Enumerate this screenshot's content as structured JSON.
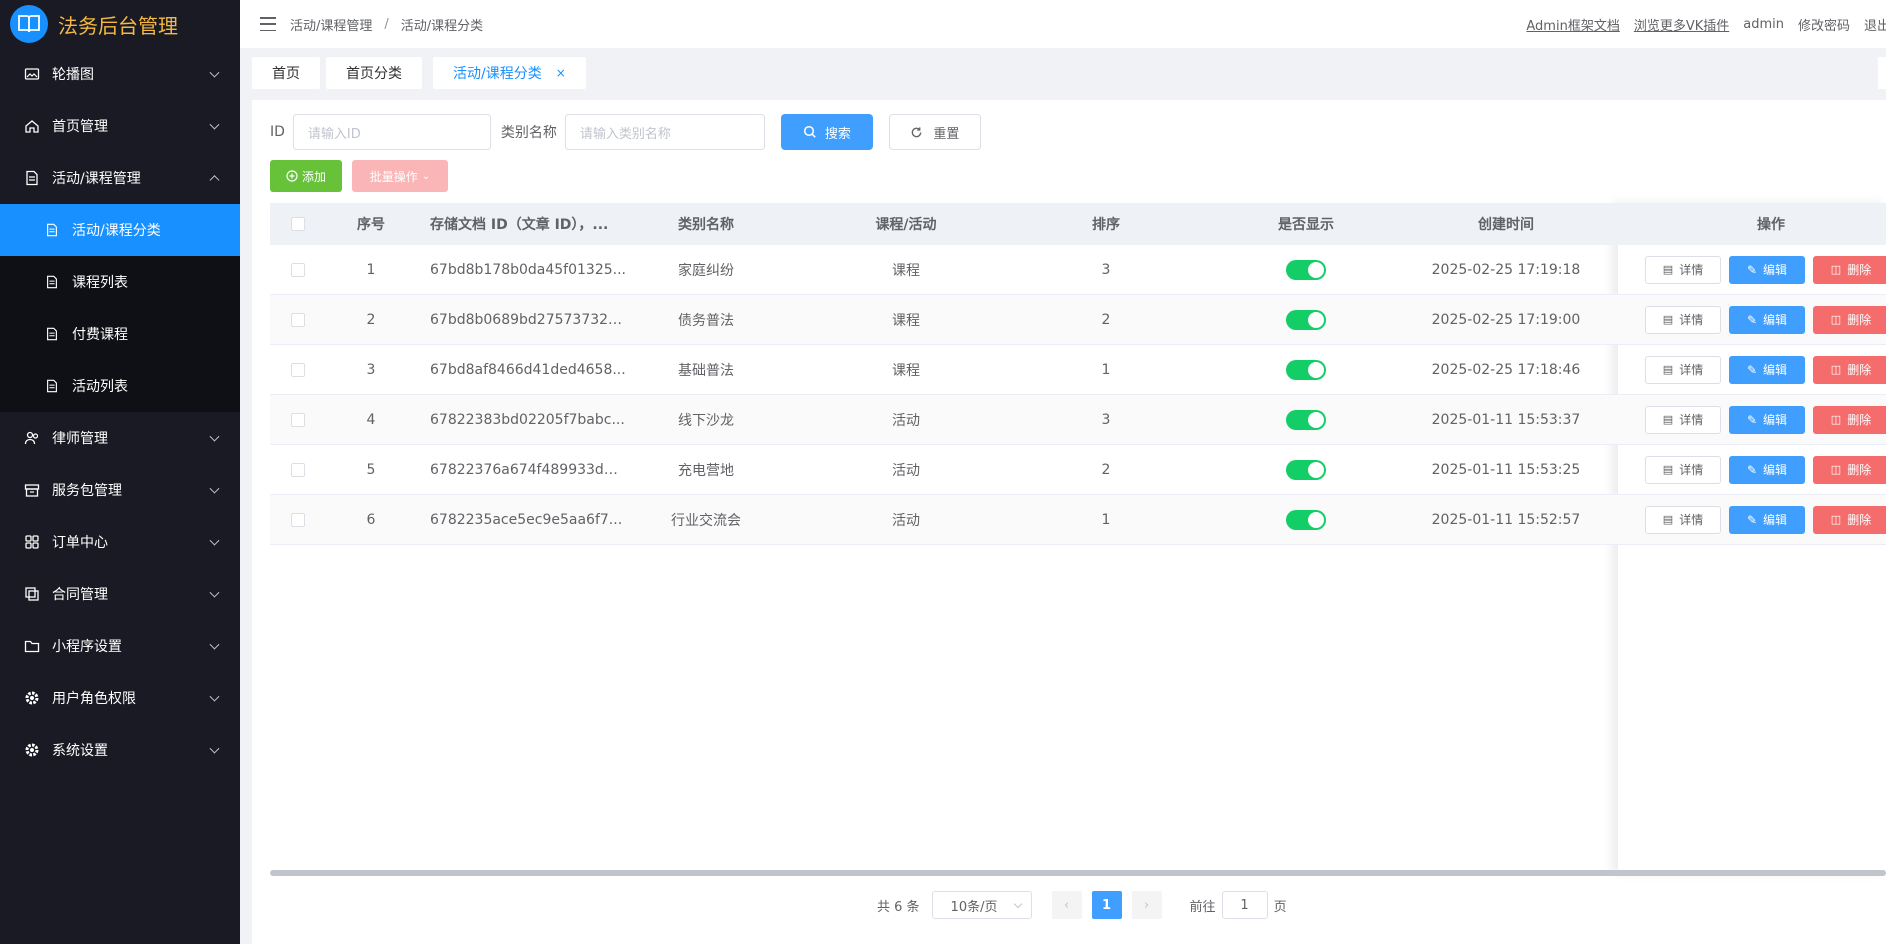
{
  "app": {
    "title": "法务后台管理"
  },
  "sidebar": {
    "items": [
      {
        "label": "轮播图",
        "icon": "image-icon"
      },
      {
        "label": "首页管理",
        "icon": "home-icon"
      },
      {
        "label": "活动/课程管理",
        "icon": "document-icon",
        "expanded": true,
        "children": [
          {
            "label": "活动/课程分类",
            "active": true
          },
          {
            "label": "课程列表"
          },
          {
            "label": "付费课程"
          },
          {
            "label": "活动列表"
          }
        ]
      },
      {
        "label": "律师管理",
        "icon": "user-group-icon"
      },
      {
        "label": "服务包管理",
        "icon": "box-icon"
      },
      {
        "label": "订单中心",
        "icon": "grid-icon"
      },
      {
        "label": "合同管理",
        "icon": "copy-icon"
      },
      {
        "label": "小程序设置",
        "icon": "folder-icon"
      },
      {
        "label": "用户角色权限",
        "icon": "gear-icon"
      },
      {
        "label": "系统设置",
        "icon": "gear-icon"
      }
    ]
  },
  "header": {
    "breadcrumb": [
      "活动/课程管理",
      "活动/课程分类"
    ],
    "links": [
      "Admin框架文档",
      "浏览更多VK插件"
    ],
    "user": "admin",
    "change_password": "修改密码",
    "logout": "退出"
  },
  "tabs": [
    {
      "label": "首页"
    },
    {
      "label": "首页分类"
    },
    {
      "label": "活动/课程分类",
      "active": true,
      "closable": "×"
    }
  ],
  "filters": {
    "id_label": "ID",
    "id_placeholder": "请输入ID",
    "name_label": "类别名称",
    "name_placeholder": "请输入类别名称",
    "search": "搜索",
    "reset": "重置"
  },
  "toolbar": {
    "add": "添加",
    "batch": "批量操作"
  },
  "table": {
    "columns": [
      "序号",
      "存储文档 ID（文章 ID），...",
      "类别名称",
      "课程/活动",
      "排序",
      "是否显示",
      "创建时间",
      "操作"
    ],
    "rows": [
      {
        "idx": "1",
        "doc": "67bd8b178b0da45f01325...",
        "name": "家庭纠纷",
        "type": "课程",
        "sort": "3",
        "show": true,
        "time": "2025-02-25 17:19:18"
      },
      {
        "idx": "2",
        "doc": "67bd8b0689bd27573732a...",
        "name": "债务普法",
        "type": "课程",
        "sort": "2",
        "show": true,
        "time": "2025-02-25 17:19:00"
      },
      {
        "idx": "3",
        "doc": "67bd8af8466d41ded4658...",
        "name": "基础普法",
        "type": "课程",
        "sort": "1",
        "show": true,
        "time": "2025-02-25 17:18:46"
      },
      {
        "idx": "4",
        "doc": "67822383bd02205f7babc...",
        "name": "线下沙龙",
        "type": "活动",
        "sort": "3",
        "show": true,
        "time": "2025-01-11 15:53:37"
      },
      {
        "idx": "5",
        "doc": "67822376a674f489933dd...",
        "name": "充电营地",
        "type": "活动",
        "sort": "2",
        "show": true,
        "time": "2025-01-11 15:53:25"
      },
      {
        "idx": "6",
        "doc": "6782235ace5ec9e5aa6f7...",
        "name": "行业交流会",
        "type": "活动",
        "sort": "1",
        "show": true,
        "time": "2025-01-11 15:52:57"
      }
    ],
    "ops": {
      "view": "详情",
      "edit": "编辑",
      "delete": "删除"
    }
  },
  "pagination": {
    "total": "共 6 条",
    "page_size": "10条/页",
    "current": "1",
    "goto_prefix": "前往",
    "goto_value": "1",
    "goto_suffix": "页"
  },
  "colors": {
    "primary": "#409eff",
    "sidebar_bg": "#191a23",
    "active_menu": "#1890ff",
    "success": "#67c23a",
    "danger": "#f56c6c",
    "switch_on": "#13ce66"
  }
}
